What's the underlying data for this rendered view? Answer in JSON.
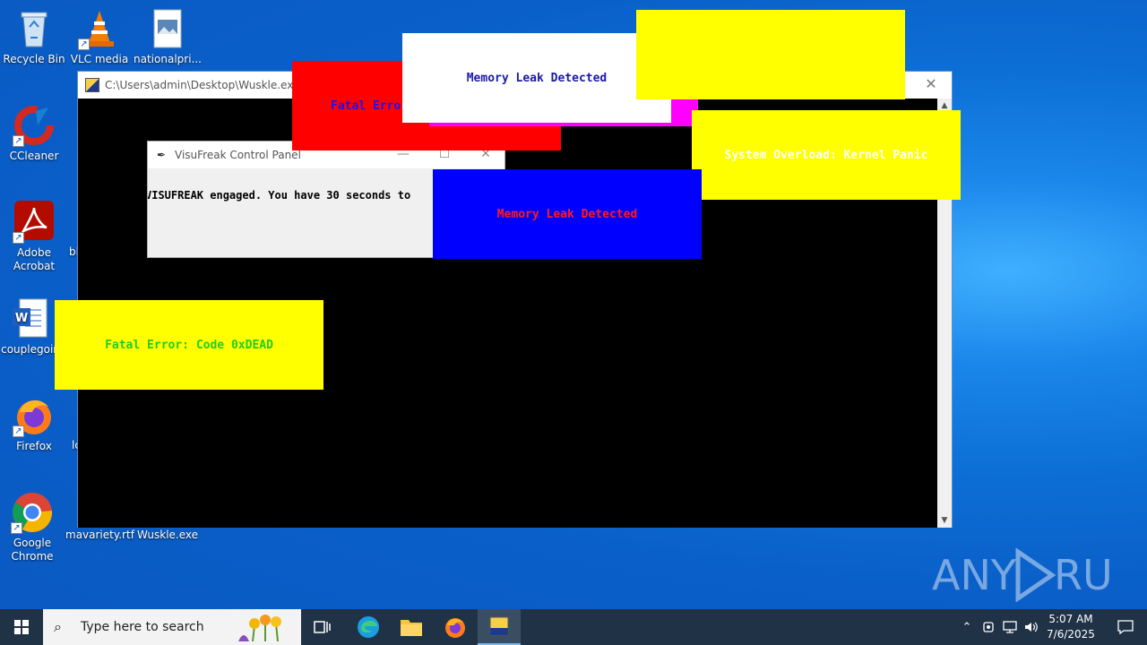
{
  "desktop": {
    "icons": [
      {
        "label": "Recycle Bin"
      },
      {
        "label": "VLC media"
      },
      {
        "label": "nationalpri..."
      },
      {
        "label": "CCleaner"
      },
      {
        "label": "Adobe Acrobat"
      },
      {
        "label": "couplegoin"
      },
      {
        "label": "Firefox"
      },
      {
        "label": "Google Chrome"
      },
      {
        "label": "mavariety.rtf"
      },
      {
        "label": "Wuskle.exe"
      }
    ],
    "partial_labels": [
      "bl",
      "lo"
    ]
  },
  "console_window": {
    "title": "C:\\Users\\admin\\Desktop\\Wuskle.exe",
    "close_glyph": "✕"
  },
  "control_panel": {
    "title": "VisuFreak Control Panel",
    "minimize_glyph": "—",
    "maximize_glyph": "☐",
    "close_glyph": "✕",
    "message": "VISUFREAK engaged. You have 30 seconds to"
  },
  "popups": [
    {
      "text": "Fatal Error",
      "bg": "#ff0000",
      "fg": "#1414ff"
    },
    {
      "text": "",
      "bg": "#ff00ff",
      "fg": "#000000"
    },
    {
      "text": "Memory Leak Detected",
      "bg": "#ffffff",
      "fg": "#1a1aa8"
    },
    {
      "text": "",
      "bg": "#ffff00",
      "fg": "#000000"
    },
    {
      "text": "System Overload: Kernel Panic",
      "bg": "#ffff00",
      "fg": "#ffffff"
    },
    {
      "text": "Memory Leak Detected",
      "bg": "#0000ff",
      "fg": "#ff1a1a"
    },
    {
      "text": "Fatal Error: Code 0xDEAD",
      "bg": "#ffff00",
      "fg": "#22cc22"
    }
  ],
  "taskbar": {
    "search_placeholder": "Type here to search",
    "clock_time": "5:07 AM",
    "clock_date": "7/6/2025"
  },
  "watermark": {
    "text": "ANY RUN"
  }
}
